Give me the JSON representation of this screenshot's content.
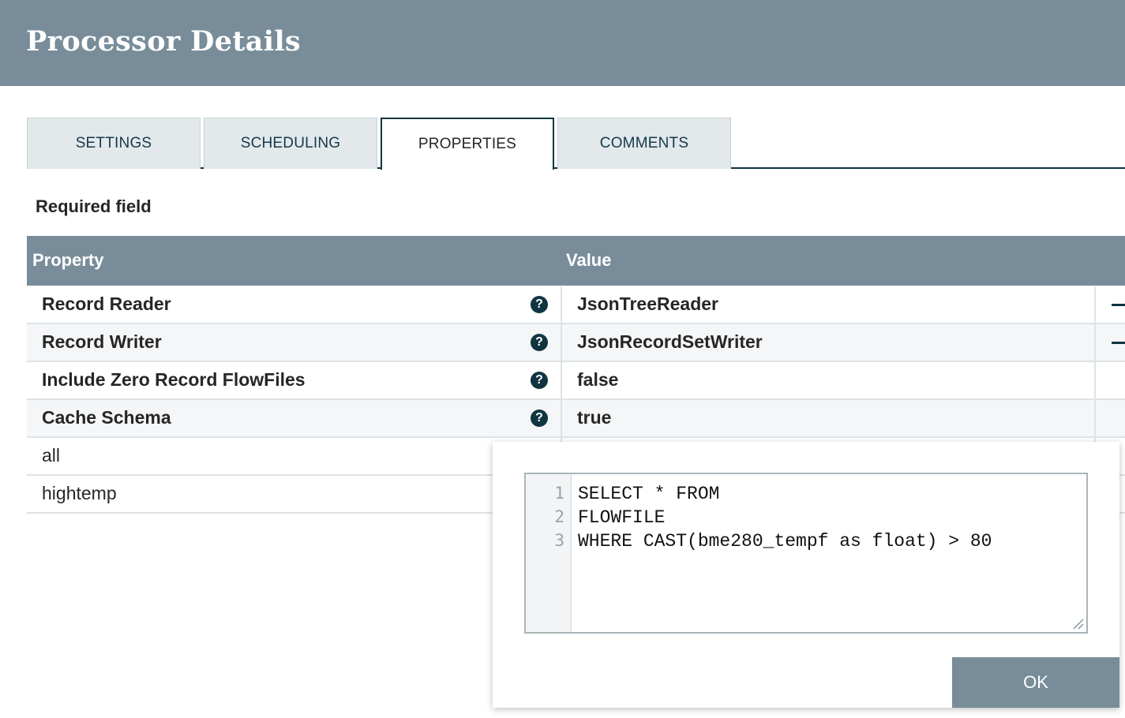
{
  "dialog": {
    "title": "Processor Details"
  },
  "tabs": [
    {
      "label": "SETTINGS"
    },
    {
      "label": "SCHEDULING"
    },
    {
      "label": "PROPERTIES",
      "active": true
    },
    {
      "label": "COMMENTS"
    }
  ],
  "required_label": "Required field",
  "table": {
    "headers": {
      "property": "Property",
      "value": "Value"
    },
    "rows": [
      {
        "name": "Record Reader",
        "value": "JsonTreeReader",
        "required": true
      },
      {
        "name": "Record Writer",
        "value": "JsonRecordSetWriter",
        "required": true
      },
      {
        "name": "Include Zero Record FlowFiles",
        "value": "false",
        "required": true
      },
      {
        "name": "Cache Schema",
        "value": "true",
        "required": true
      },
      {
        "name": "all",
        "value": "",
        "required": false
      },
      {
        "name": "hightemp",
        "value": "",
        "required": false
      }
    ]
  },
  "editor": {
    "lines": [
      {
        "num": "1",
        "text": "SELECT * FROM"
      },
      {
        "num": "2",
        "text": "FLOWFILE"
      },
      {
        "num": "3",
        "text": "WHERE CAST(bme280_tempf as float) > 80"
      }
    ],
    "ok_label": "OK"
  },
  "icons": {
    "help": "question-circle-icon",
    "goto": "arrow-right-icon",
    "resize": "resize-handle-icon"
  },
  "colors": {
    "header_bg": "#788d99",
    "accent_dark": "#0f3540",
    "tab_bg": "#e3e8eb"
  }
}
